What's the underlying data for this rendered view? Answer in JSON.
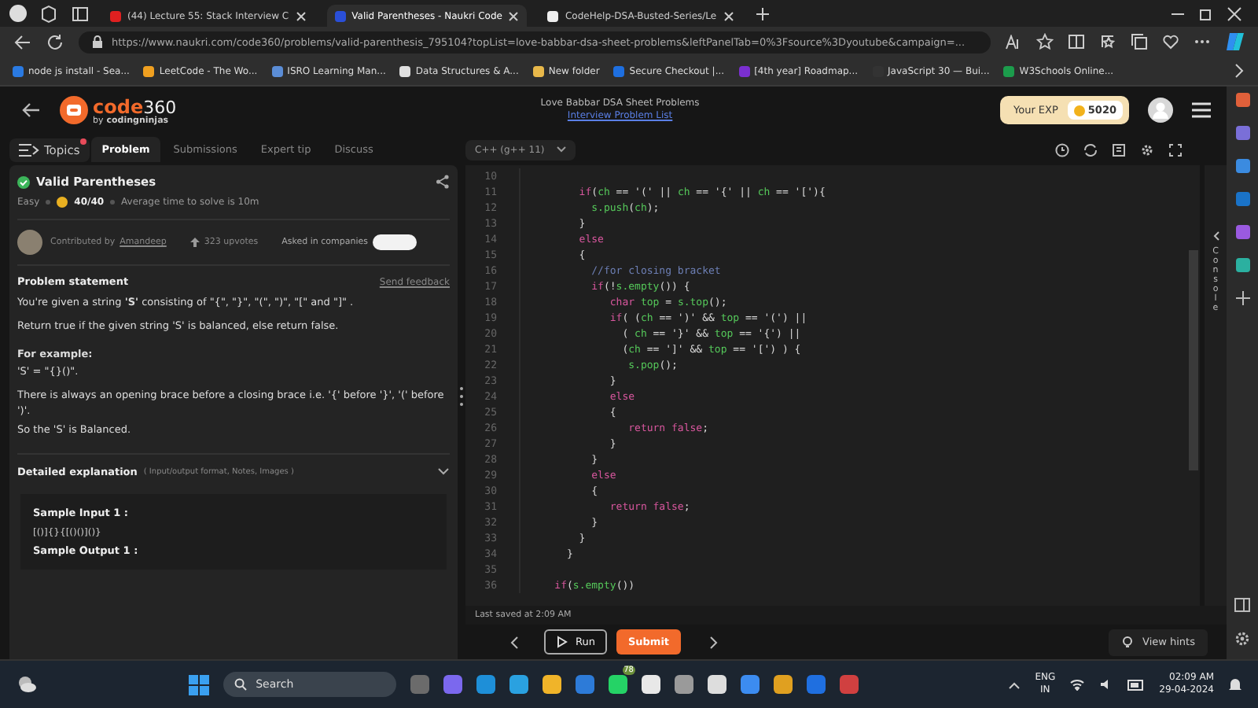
{
  "browser": {
    "tabs": [
      {
        "title": "(44) Lecture 55: Stack Interview C",
        "selected": false
      },
      {
        "title": "Valid Parentheses - Naukri Code",
        "selected": true
      },
      {
        "title": "CodeHelp-DSA-Busted-Series/Le",
        "selected": false
      }
    ],
    "url": "https://www.naukri.com/code360/problems/valid-parenthesis_795104?topList=love-babbar-dsa-sheet-problems&leftPanelTab=0%3Fsource%3Dyoutube&campaign=...",
    "bookmarks": [
      "node js install - Sea...",
      "LeetCode - The Wo...",
      "ISRO Learning Man...",
      "Data Structures & A...",
      "New folder",
      "Secure Checkout |...",
      "[4th year] Roadmap...",
      "JavaScript 30 — Bui...",
      "W3Schools Online..."
    ]
  },
  "header": {
    "logo": "code",
    "logo_num": "360",
    "logo_by": "by",
    "logo_brand": "codingninjas",
    "title": "Love Babbar DSA Sheet Problems",
    "link": "Interview Problem List",
    "exp_label": "Your EXP",
    "exp_value": "5020"
  },
  "topics": {
    "label": "Topics",
    "unread": true
  },
  "nav_tabs": [
    {
      "label": "Problem",
      "selected": true
    },
    {
      "label": "Submissions",
      "selected": false
    },
    {
      "label": "Expert tip",
      "selected": false
    },
    {
      "label": "Discuss",
      "selected": false
    }
  ],
  "problem": {
    "title": "Valid Parentheses",
    "solved": true,
    "difficulty": "Easy",
    "score": "40/40",
    "avg_time": "Average time to solve is 10m",
    "contributed_by": "Contributed by",
    "author": "Amandeep",
    "upvotes": "323 upvotes",
    "companies": "Asked in companies"
  },
  "statement": {
    "heading": "Problem statement",
    "feedback": "Send feedback",
    "blocks": [
      {
        "kind": "text",
        "text": "You're given a string **'S'** consisting of \"{\", \"}\", \"(\", \")\", \"[\" and \"]\" ."
      },
      {
        "kind": "text",
        "text": "Return true if the given string 'S' is balanced, else return false."
      },
      {
        "kind": "heading",
        "text": "For example:"
      },
      {
        "kind": "line",
        "text": "'S' = \"{}()\"."
      },
      {
        "kind": "text",
        "text": "There is always an opening brace before a closing brace i.e. '{' before '}', '(' before ')'."
      },
      {
        "kind": "line",
        "text": "So the 'S' is Balanced."
      }
    ],
    "details": "Detailed explanation",
    "details_note": "( Input/output format, Notes, Images )",
    "expanded": false,
    "sample_input_label": "Sample Input 1 :",
    "sample_input": "[()]{}{[()()]()}",
    "sample_output_label": "Sample Output 1 :"
  },
  "editor": {
    "language": "C++ (g++ 11)",
    "console": "Console",
    "last_saved": "Last saved at 2:09 AM",
    "run": "Run",
    "submit": "Submit",
    "hints": "View hints",
    "lines": [
      {
        "number": "10"
      },
      {
        "number": "11",
        "tokens": [
          {
            "kind": "kw",
            "text": "        if"
          },
          {
            "kind": "p",
            "text": "("
          },
          {
            "kind": "v",
            "text": "ch"
          },
          {
            "kind": "p",
            "text": " == '(' || "
          },
          {
            "kind": "v",
            "text": "ch"
          },
          {
            "kind": "p",
            "text": " == '{' || "
          },
          {
            "kind": "v",
            "text": "ch"
          },
          {
            "kind": "p",
            "text": " == '['){"
          }
        ]
      },
      {
        "number": "12",
        "tokens": [
          {
            "kind": "v",
            "text": "          s.push"
          },
          {
            "kind": "p",
            "text": "("
          },
          {
            "kind": "v",
            "text": "ch"
          },
          {
            "kind": "p",
            "text": ");"
          }
        ]
      },
      {
        "number": "13",
        "tokens": [
          {
            "kind": "p",
            "text": "        }"
          }
        ]
      },
      {
        "number": "14",
        "tokens": [
          {
            "kind": "kw",
            "text": "        else"
          }
        ]
      },
      {
        "number": "15",
        "tokens": [
          {
            "kind": "p",
            "text": "        {"
          }
        ]
      },
      {
        "number": "16",
        "tokens": [
          {
            "kind": "c",
            "text": "          //for closing bracket"
          }
        ]
      },
      {
        "number": "17",
        "tokens": [
          {
            "kind": "kw",
            "text": "          if"
          },
          {
            "kind": "p",
            "text": "(!"
          },
          {
            "kind": "v",
            "text": "s.empty"
          },
          {
            "kind": "p",
            "text": "()) {"
          }
        ]
      },
      {
        "number": "18",
        "tokens": [
          {
            "kind": "kw",
            "text": "             char"
          },
          {
            "kind": "v",
            "text": " top"
          },
          {
            "kind": "p",
            "text": " = "
          },
          {
            "kind": "v",
            "text": "s.top"
          },
          {
            "kind": "p",
            "text": "();"
          }
        ]
      },
      {
        "number": "19",
        "tokens": [
          {
            "kind": "kw",
            "text": "             if"
          },
          {
            "kind": "p",
            "text": "( ("
          },
          {
            "kind": "v",
            "text": "ch"
          },
          {
            "kind": "p",
            "text": " == ')' && "
          },
          {
            "kind": "v",
            "text": "top"
          },
          {
            "kind": "p",
            "text": " == '(') ||"
          }
        ]
      },
      {
        "number": "20",
        "tokens": [
          {
            "kind": "p",
            "text": "               ( "
          },
          {
            "kind": "v",
            "text": "ch"
          },
          {
            "kind": "p",
            "text": " == '}' && "
          },
          {
            "kind": "v",
            "text": "top"
          },
          {
            "kind": "p",
            "text": " == '{') ||"
          }
        ]
      },
      {
        "number": "21",
        "tokens": [
          {
            "kind": "p",
            "text": "               ("
          },
          {
            "kind": "v",
            "text": "ch"
          },
          {
            "kind": "p",
            "text": " == ']' && "
          },
          {
            "kind": "v",
            "text": "top"
          },
          {
            "kind": "p",
            "text": " == '[') ) {"
          }
        ]
      },
      {
        "number": "22",
        "tokens": [
          {
            "kind": "v",
            "text": "                s.pop"
          },
          {
            "kind": "p",
            "text": "();"
          }
        ]
      },
      {
        "number": "23",
        "tokens": [
          {
            "kind": "p",
            "text": "             }"
          }
        ]
      },
      {
        "number": "24",
        "tokens": [
          {
            "kind": "kw",
            "text": "             else"
          }
        ]
      },
      {
        "number": "25",
        "tokens": [
          {
            "kind": "p",
            "text": "             {"
          }
        ]
      },
      {
        "number": "26",
        "tokens": [
          {
            "kind": "kw",
            "text": "                return false"
          },
          {
            "kind": "p",
            "text": ";"
          }
        ]
      },
      {
        "number": "27",
        "tokens": [
          {
            "kind": "p",
            "text": "             }"
          }
        ]
      },
      {
        "number": "28",
        "tokens": [
          {
            "kind": "p",
            "text": "          }"
          }
        ]
      },
      {
        "number": "29",
        "tokens": [
          {
            "kind": "kw",
            "text": "          else"
          }
        ]
      },
      {
        "number": "30",
        "tokens": [
          {
            "kind": "p",
            "text": "          {"
          }
        ]
      },
      {
        "number": "31",
        "tokens": [
          {
            "kind": "kw",
            "text": "             return false"
          },
          {
            "kind": "p",
            "text": ";"
          }
        ]
      },
      {
        "number": "32",
        "tokens": [
          {
            "kind": "p",
            "text": "          }"
          }
        ]
      },
      {
        "number": "33",
        "tokens": [
          {
            "kind": "p",
            "text": "        }"
          }
        ]
      },
      {
        "number": "34",
        "tokens": [
          {
            "kind": "p",
            "text": "      }"
          }
        ]
      },
      {
        "number": "35"
      },
      {
        "number": "36",
        "tokens": [
          {
            "kind": "kw",
            "text": "    if"
          },
          {
            "kind": "p",
            "text": "("
          },
          {
            "kind": "v",
            "text": "s.empty"
          },
          {
            "kind": "p",
            "text": "())"
          }
        ]
      }
    ]
  },
  "taskbar": {
    "search": "Search",
    "whatsapp_badge": "78",
    "language": "ENG",
    "region": "IN",
    "time": "02:09 AM",
    "date": "29-04-2024"
  }
}
